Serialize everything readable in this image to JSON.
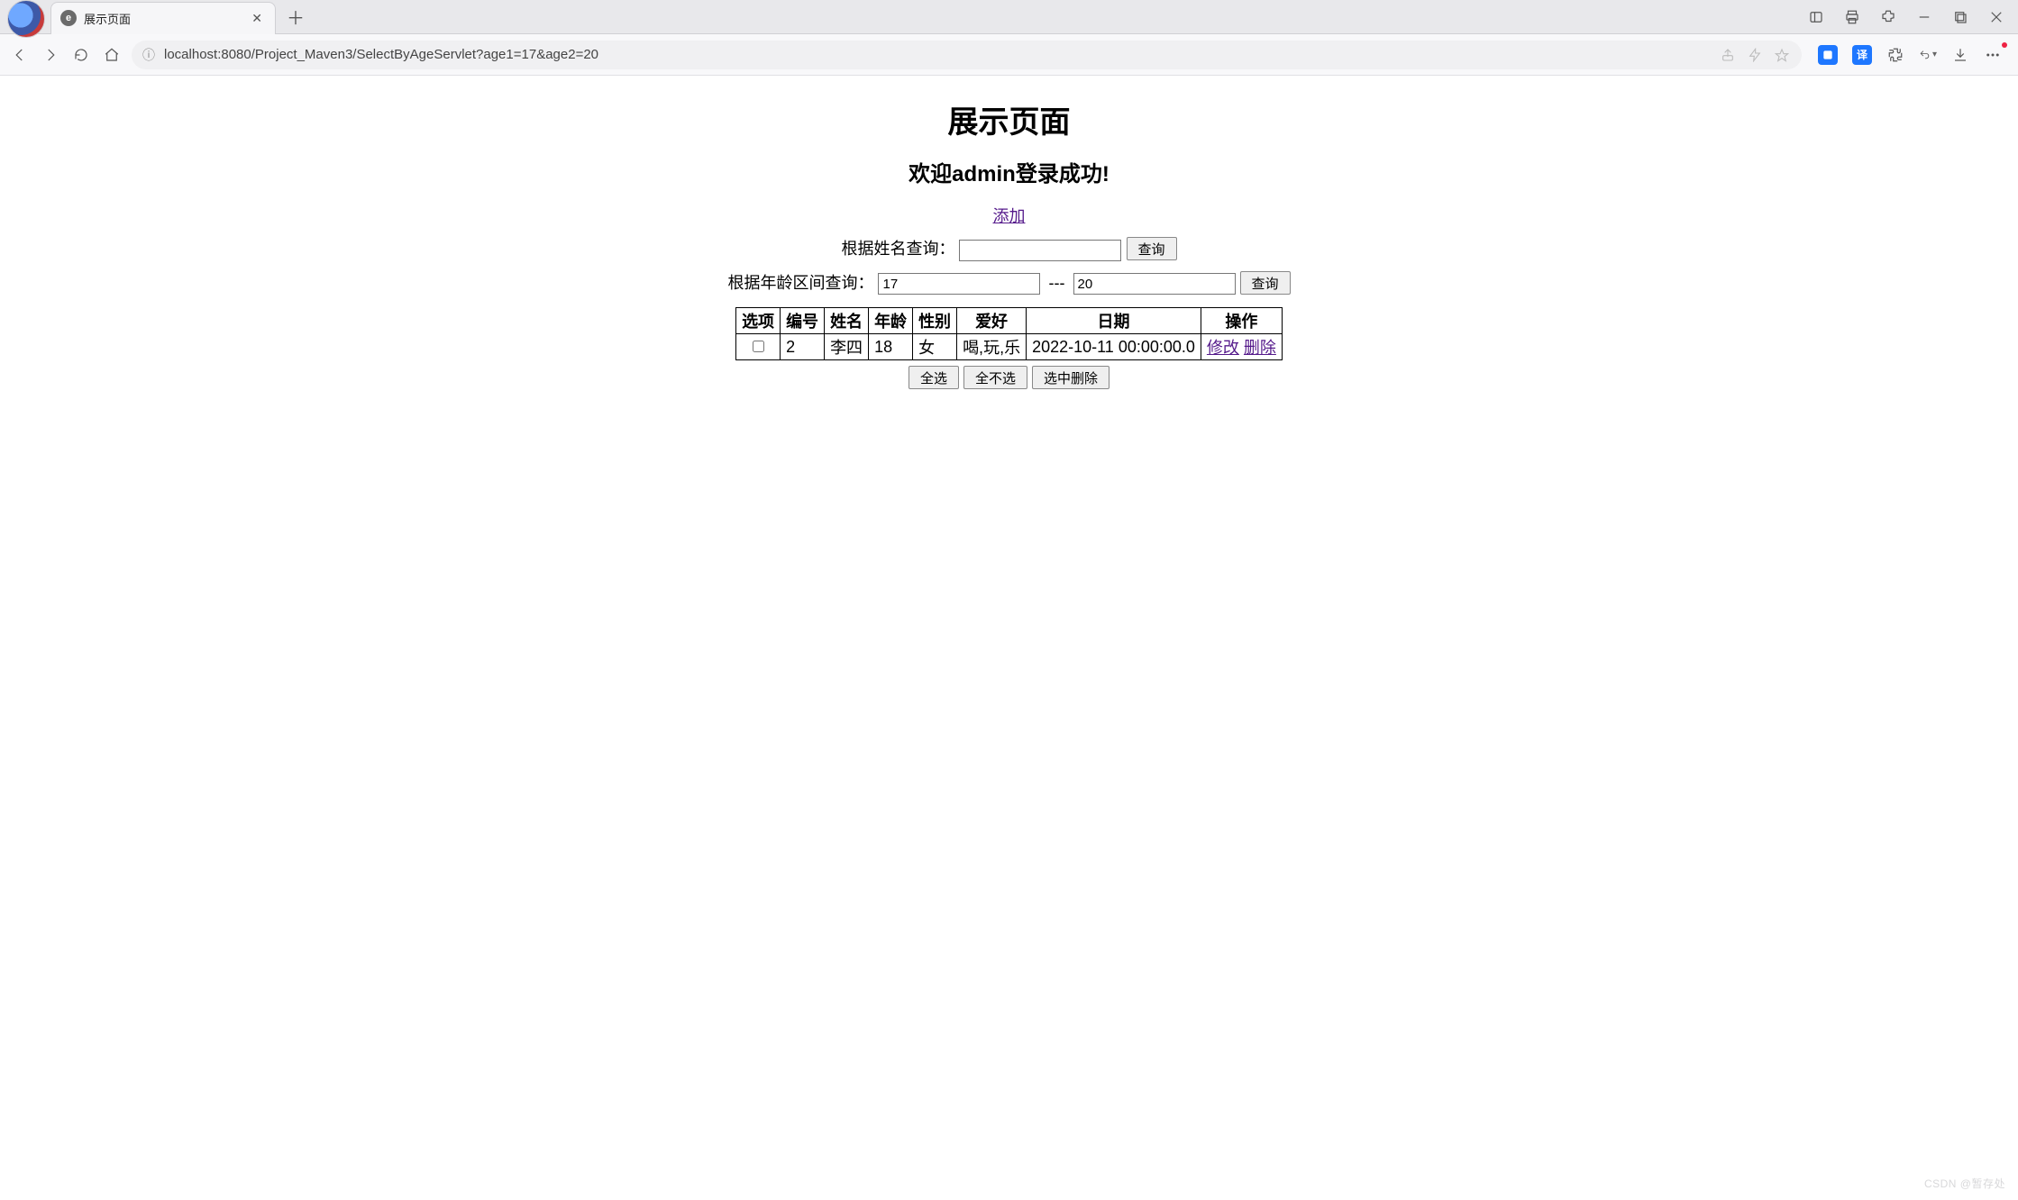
{
  "browser": {
    "tab_title": "展示页面",
    "url": "localhost:8080/Project_Maven3/SelectByAgeServlet?age1=17&age2=20",
    "favicon_letter": "e",
    "translate_chip": "译"
  },
  "page": {
    "title": "展示页面",
    "welcome": "欢迎admin登录成功!",
    "add_link_label": "添加",
    "search_name": {
      "label": "根据姓名查询：",
      "value": "",
      "button": "查询"
    },
    "search_age": {
      "label": "根据年龄区间查询：",
      "age1": "17",
      "age2": "20",
      "separator": "---",
      "button": "查询"
    },
    "table": {
      "headers": [
        "选项",
        "编号",
        "姓名",
        "年龄",
        "性别",
        "爱好",
        "日期",
        "操作"
      ],
      "rows": [
        {
          "checked": false,
          "id": "2",
          "name": "李四",
          "age": "18",
          "gender": "女",
          "hobby": "喝,玩,乐",
          "date": "2022-10-11 00:00:00.0",
          "op_edit": "修改",
          "op_delete": "删除"
        }
      ]
    },
    "batch_buttons": {
      "select_all": "全选",
      "select_none": "全不选",
      "delete_selected": "选中删除"
    }
  },
  "watermark": "CSDN @暂存处"
}
